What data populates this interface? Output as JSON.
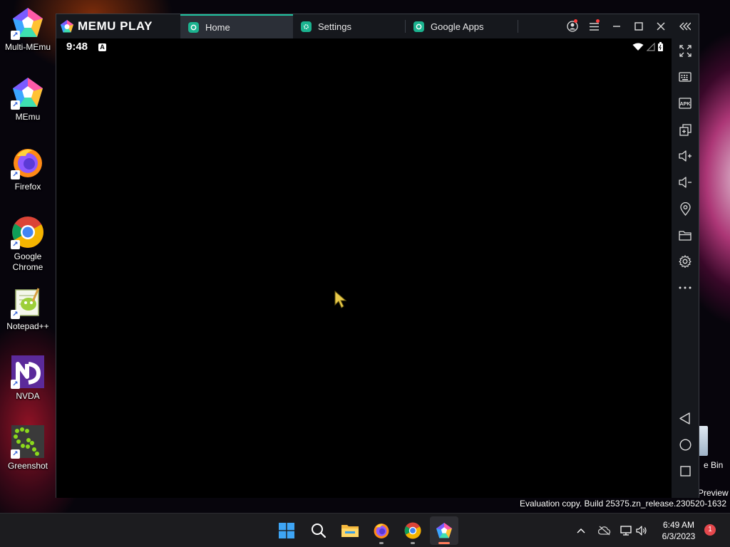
{
  "desktop": {
    "icons": [
      {
        "label_line1": "Multi-MEmu",
        "label_line2": ""
      },
      {
        "label_line1": "MEmu",
        "label_line2": ""
      },
      {
        "label_line1": "Firefox",
        "label_line2": ""
      },
      {
        "label_line1": "Google",
        "label_line2": "Chrome"
      },
      {
        "label_line1": "Notepad++",
        "label_line2": ""
      },
      {
        "label_line1": "NVDA",
        "label_line2": ""
      },
      {
        "label_line1": "Greenshot",
        "label_line2": ""
      }
    ],
    "recycle_bin_partial_label": "e Bin",
    "preview_partial_label": "Preview",
    "evaluation_text": "Evaluation copy. Build 25375.zn_release.230520-1632"
  },
  "emulator": {
    "logo_text": "MEMU PLAY",
    "tabs": [
      {
        "label": "Home",
        "active": true
      },
      {
        "label": "Settings",
        "active": false
      },
      {
        "label": "Google Apps",
        "active": false
      }
    ],
    "title_controls": [
      "account-icon",
      "menu-icon",
      "minimize-icon",
      "maximize-icon",
      "close-icon",
      "collapse-sidebar-icon"
    ],
    "status_bar": {
      "time": "9:48",
      "notification_glyph": "A"
    },
    "sidebar_tools": [
      "fullscreen-icon",
      "keyboard-mapping-icon",
      "apk-install-icon",
      "multi-window-icon",
      "volume-up-icon",
      "volume-down-icon",
      "location-icon",
      "shared-folder-icon",
      "settings-icon",
      "more-icon"
    ],
    "nav_buttons": [
      "back-icon",
      "home-icon",
      "recents-icon"
    ],
    "accent_color": "#1fc2a0"
  },
  "taskbar": {
    "apps": [
      "start-icon",
      "search-icon",
      "file-explorer-icon",
      "firefox-icon",
      "chrome-icon",
      "memu-icon"
    ],
    "clock_time": "6:49 AM",
    "clock_date": "6/3/2023",
    "notification_count": "1"
  }
}
